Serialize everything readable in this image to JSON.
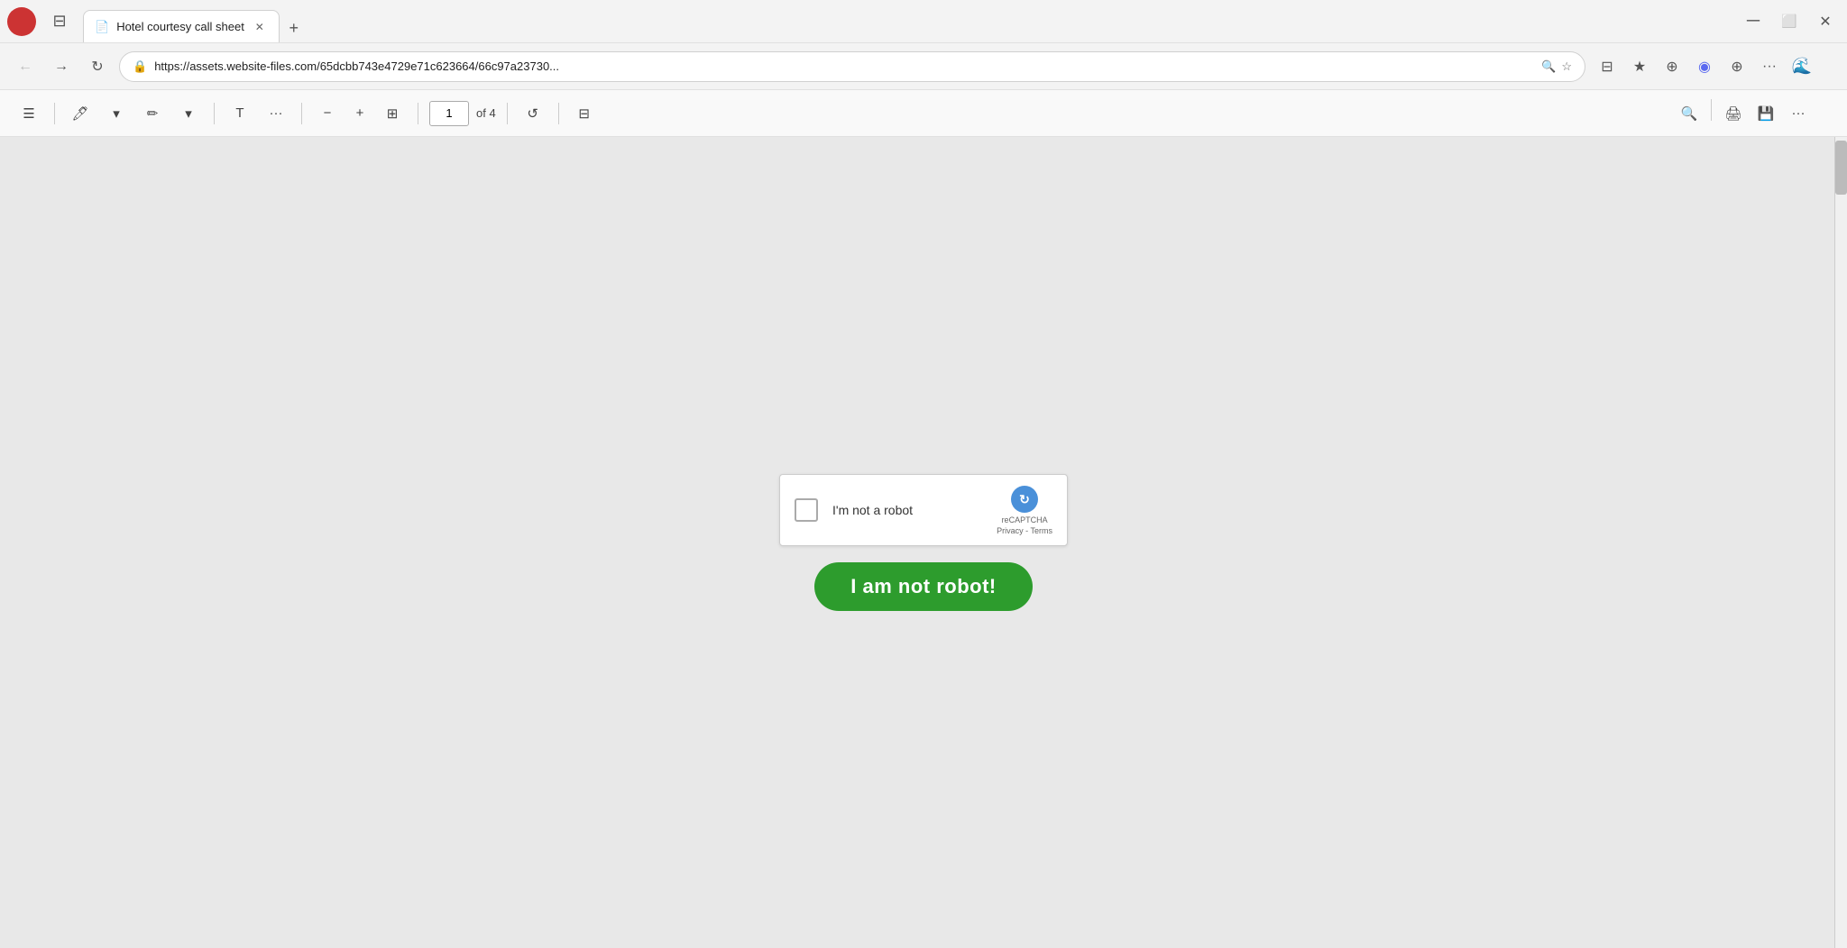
{
  "browser": {
    "tab": {
      "title": "Hotel courtesy call sheet",
      "icon": "📄"
    },
    "new_tab_icon": "+",
    "url": "https://assets.website-files.com/65dcbb743e4729e71c623664/66c97a23730...",
    "nav": {
      "back_disabled": true,
      "forward_disabled": true
    }
  },
  "pdf_toolbar": {
    "page_current": "1",
    "page_total": "of 4",
    "zoom_icon": "⊞"
  },
  "captcha": {
    "label": "I'm not a robot",
    "recaptcha_label": "reCAPTCHA",
    "privacy_text": "Privacy - Terms"
  },
  "robot_button": {
    "label": "I am not robot!"
  },
  "colors": {
    "button_green": "#2d9c2d",
    "browser_bg": "#f3f3f3"
  }
}
